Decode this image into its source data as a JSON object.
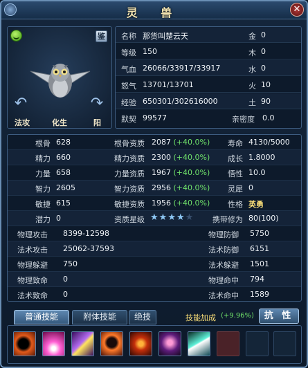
{
  "window": {
    "title": "灵 兽",
    "close": "✕"
  },
  "portrait": {
    "appraise_label": "鉴",
    "labels": [
      "法攻",
      "化生",
      "阳"
    ],
    "arrows": [
      "↶",
      "↷"
    ]
  },
  "info": {
    "name_label": "名称",
    "name": "那货叫楚云天",
    "level_label": "等级",
    "level": "150",
    "hp_label": "气血",
    "hp": "26066/33917/33917",
    "rage_label": "怒气",
    "rage": "13701/13701",
    "exp_label": "经验",
    "exp": "650301/302616000",
    "tacit_label": "默契",
    "tacit": "99577",
    "elements": [
      {
        "label": "金",
        "value": "0"
      },
      {
        "label": "木",
        "value": "0"
      },
      {
        "label": "水",
        "value": "0"
      },
      {
        "label": "火",
        "value": "10"
      },
      {
        "label": "土",
        "value": "90"
      }
    ],
    "intimacy_label": "亲密度",
    "intimacy": "0.0"
  },
  "stats": {
    "rows": [
      {
        "l1": "根骨",
        "v1": "628",
        "l2": "根骨资质",
        "v2": "2087",
        "b2": "(+40.0%)",
        "l3": "寿命",
        "v3": "4130/5000"
      },
      {
        "l1": "精力",
        "v1": "660",
        "l2": "精力资质",
        "v2": "2300",
        "b2": "(+40.0%)",
        "l3": "成长",
        "v3": "1.8000"
      },
      {
        "l1": "力量",
        "v1": "658",
        "l2": "力量资质",
        "v2": "1967",
        "b2": "(+40.0%)",
        "l3": "悟性",
        "v3": "10.0"
      },
      {
        "l1": "智力",
        "v1": "2605",
        "l2": "智力资质",
        "v2": "2956",
        "b2": "(+40.0%)",
        "l3": "灵犀",
        "v3": "0"
      },
      {
        "l1": "敏捷",
        "v1": "615",
        "l2": "敏捷资质",
        "v2": "1956",
        "b2": "(+40.0%)",
        "l3": "性格",
        "v3": "英勇"
      }
    ],
    "potential_label": "潜力",
    "potential": "0",
    "star_label": "资质星级",
    "stars": 4,
    "stars_max": 5,
    "carry_label": "携带修为",
    "carry": "80(100)",
    "combat": [
      {
        "l1": "物理攻击",
        "v1": "8399-12598",
        "l2": "物理防御",
        "v2": "5750"
      },
      {
        "l1": "法术攻击",
        "v1": "25062-37593",
        "l2": "法术防御",
        "v2": "6151"
      },
      {
        "l1": "物理躲避",
        "v1": "750",
        "l2": "法术躲避",
        "v2": "1501"
      },
      {
        "l1": "物理致命",
        "v1": "0",
        "l2": "物理命中",
        "v2": "794"
      },
      {
        "l1": "法术致命",
        "v1": "0",
        "l2": "法术命中",
        "v2": "1589"
      }
    ]
  },
  "tabs": [
    "普通技能",
    "附体技能",
    "绝技"
  ],
  "skill_bonus_label": "技能加成",
  "skill_bonus_value": "(+9.96%)",
  "resist_label": "抗 性",
  "skills": [
    "dark-claw-icon",
    "pink-burst-icon",
    "purple-slash-icon",
    "fire-beast-icon",
    "flame-eye-icon",
    "shadow-bird-icon",
    "ice-blade-icon"
  ]
}
